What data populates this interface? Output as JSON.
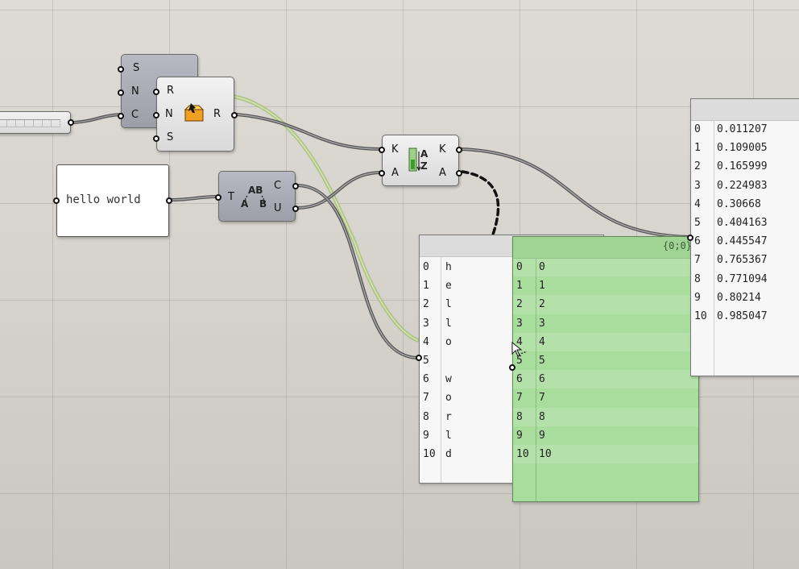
{
  "canvas_colors": {
    "background": "#d9d7d0",
    "wire": "#5c5c5c",
    "wire_selected": "#b7c98a",
    "panel_green": "#a9dd9e"
  },
  "slider": {
    "name": "number-slider"
  },
  "split_component": {
    "inputs": [
      "S",
      "N",
      "C"
    ]
  },
  "random_component": {
    "inputs": [
      "R",
      "N",
      "S"
    ],
    "outputs": [
      "R"
    ],
    "icon": "random-box-icon"
  },
  "sort_component": {
    "inputs": [
      "K",
      "A"
    ],
    "outputs": [
      "K",
      "A"
    ],
    "icon": "sort-az-icon"
  },
  "text_component": {
    "inputs": [
      "T"
    ],
    "outputs": [
      "C",
      "U"
    ],
    "icon": "characters-ab-icon"
  },
  "text_panel": {
    "text": "hello world"
  },
  "chars_panel": {
    "rows": [
      {
        "i": "0",
        "v": "h"
      },
      {
        "i": "1",
        "v": "e"
      },
      {
        "i": "2",
        "v": "l"
      },
      {
        "i": "3",
        "v": "l"
      },
      {
        "i": "4",
        "v": "o"
      },
      {
        "i": "5",
        "v": ""
      },
      {
        "i": "6",
        "v": "w"
      },
      {
        "i": "7",
        "v": "o"
      },
      {
        "i": "8",
        "v": "r"
      },
      {
        "i": "9",
        "v": "l"
      },
      {
        "i": "10",
        "v": "d"
      }
    ]
  },
  "index_panel": {
    "path": "{0;0}",
    "rows": [
      {
        "i": "0",
        "v": "0"
      },
      {
        "i": "1",
        "v": "1"
      },
      {
        "i": "2",
        "v": "2"
      },
      {
        "i": "3",
        "v": "3"
      },
      {
        "i": "4",
        "v": "4"
      },
      {
        "i": "5",
        "v": "5"
      },
      {
        "i": "6",
        "v": "6"
      },
      {
        "i": "7",
        "v": "7"
      },
      {
        "i": "8",
        "v": "8"
      },
      {
        "i": "9",
        "v": "9"
      },
      {
        "i": "10",
        "v": "10"
      }
    ]
  },
  "random_panel": {
    "rows": [
      {
        "i": "0",
        "v": "0.011207"
      },
      {
        "i": "1",
        "v": "0.109005"
      },
      {
        "i": "2",
        "v": "0.165999"
      },
      {
        "i": "3",
        "v": "0.224983"
      },
      {
        "i": "4",
        "v": "0.30668"
      },
      {
        "i": "5",
        "v": "0.404163"
      },
      {
        "i": "6",
        "v": "0.445547"
      },
      {
        "i": "7",
        "v": "0.765367"
      },
      {
        "i": "8",
        "v": "0.771094"
      },
      {
        "i": "9",
        "v": "0.80214"
      },
      {
        "i": "10",
        "v": "0.985047"
      }
    ]
  }
}
